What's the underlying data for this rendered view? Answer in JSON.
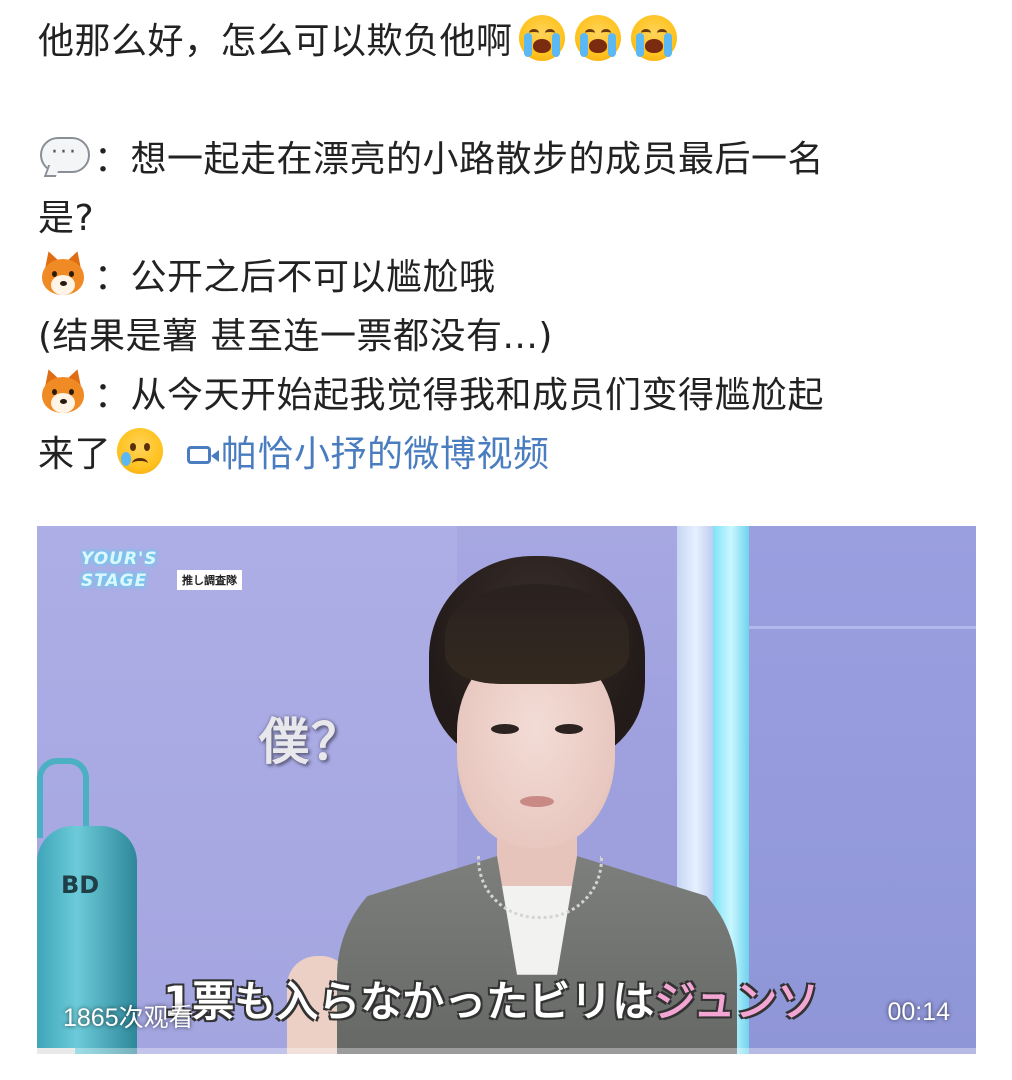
{
  "post": {
    "line1": "他那么好，怎么可以欺负他啊",
    "line3_text": "：想一起走在漂亮的小路散步的成员最后一名",
    "line4": "是?",
    "line5_text": "：公开之后不可以尴尬哦",
    "line6": "(结果是薯 甚至连一票都没有...)",
    "line7_text": "：从今天开始起我觉得我和成员们变得尴尬起",
    "line8": "来了",
    "video_link": "帕恰小抒的微博视频",
    "icons": {
      "crying": "loudly-crying-face-icon",
      "speech": "speech-bubble-icon",
      "fox": "fox-face-icon",
      "sad_tear": "sad-but-relieved-face-icon",
      "video": "video-camera-icon"
    }
  },
  "video": {
    "logo_text_1": "YOUR'S",
    "logo_text_2": "STAGE",
    "logo_tag": "推し調査隊",
    "caption_question": "僕？",
    "subtitle_main": "1票も入らなかったビリは",
    "subtitle_name": "ジュンソ",
    "tank_label": "BD",
    "views": "1865次观看",
    "duration": "00:14",
    "progress": 0.04
  },
  "colors": {
    "link": "#4a7dbf",
    "text": "#222222",
    "subtitle_highlight": "#f3a6d3"
  }
}
